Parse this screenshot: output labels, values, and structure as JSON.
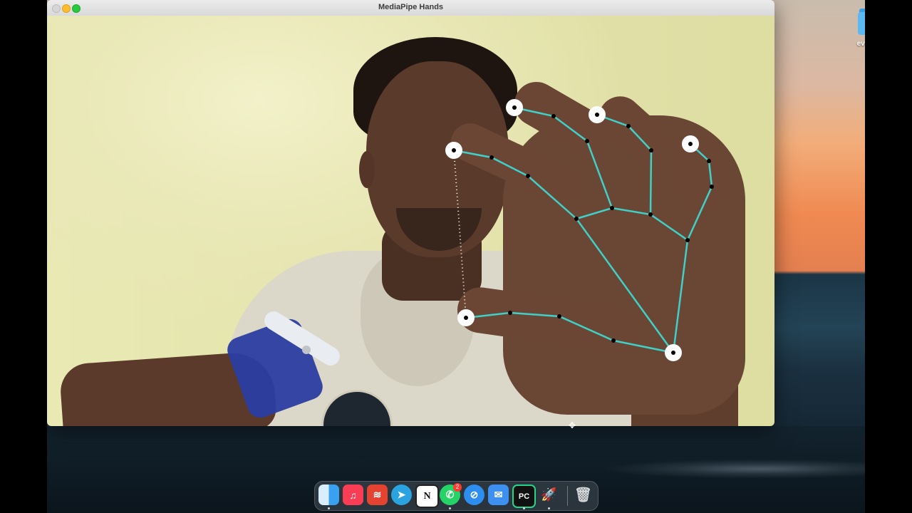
{
  "window": {
    "title": "MediaPipe Hands",
    "traffic_lights": [
      "close",
      "minimize",
      "zoom"
    ]
  },
  "desktop": {
    "folder_label": "everything",
    "folder_icon": "folder-icon",
    "folder_color": "#5cb8f0"
  },
  "hand_overlay": {
    "connection_color": "#40d0c8",
    "landmark_color": "#000000",
    "fingertip_marker_color": "#ffffff",
    "guide_line": "dotted"
  },
  "dock": {
    "apps": [
      {
        "name": "Finder",
        "icon": "finder-icon",
        "color": "#3aa0f0",
        "running": true
      },
      {
        "name": "Music",
        "icon": "music-icon",
        "color": "#fa3d55",
        "running": false
      },
      {
        "name": "Todoist",
        "icon": "todoist-icon",
        "color": "#e44332",
        "running": false
      },
      {
        "name": "Telegram",
        "icon": "telegram-icon",
        "color": "#2aa3e0",
        "running": false
      },
      {
        "name": "Notion",
        "icon": "notion-icon",
        "color": "#ffffff",
        "running": false
      },
      {
        "name": "WhatsApp",
        "icon": "whatsapp-icon",
        "color": "#25d366",
        "running": true
      },
      {
        "name": "Safari",
        "icon": "safari-icon",
        "color": "#2d8ef0",
        "running": false
      },
      {
        "name": "Mail",
        "icon": "mail-icon",
        "color": "#3d8ff0",
        "running": false
      },
      {
        "name": "PyCharm",
        "icon": "pycharm-icon",
        "color": "#21d789",
        "running": true
      },
      {
        "name": "Rocket",
        "icon": "rocket-icon",
        "color": "#9aa0a6",
        "running": true
      },
      {
        "name": "Trash",
        "icon": "trash-icon",
        "color": "#cfd3d6",
        "running": false
      }
    ],
    "whatsapp_badge": "2",
    "notion_glyph": "N",
    "pycharm_glyph": "PC"
  }
}
